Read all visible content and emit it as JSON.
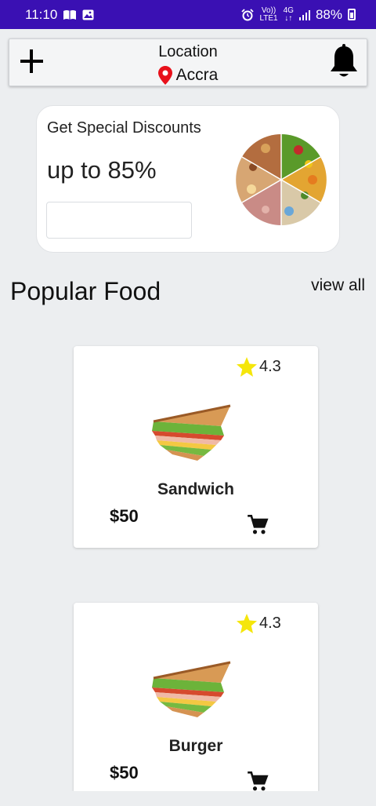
{
  "status_bar": {
    "time": "11:10",
    "network_top": "Vo))",
    "network_bottom": "LTE1",
    "net_type_top": "4G",
    "net_type_bottom": "↓↑",
    "battery": "88%"
  },
  "header": {
    "location_label": "Location",
    "city": "Accra",
    "pin_color": "#e8111b"
  },
  "promo": {
    "title": "Get Special Discounts",
    "discount": "up to 85%",
    "input_value": ""
  },
  "popular": {
    "title": "Popular Food",
    "view_all": "view all",
    "items": [
      {
        "rating": "4.3",
        "name": "Sandwich",
        "price": "$50",
        "image": "sandwich-image"
      },
      {
        "rating": "4.3",
        "name": "Burger",
        "price": "$50",
        "image": "sandwich-image"
      }
    ]
  },
  "colors": {
    "status_bar": "#3a10b3",
    "star": "#f5e60b",
    "background": "#eceef0"
  },
  "icons": [
    "book-icon",
    "image-icon",
    "alarm-icon",
    "signal-icon",
    "battery-icon",
    "plus-icon",
    "location-pin-icon",
    "bell-icon",
    "star-icon",
    "cart-icon"
  ]
}
